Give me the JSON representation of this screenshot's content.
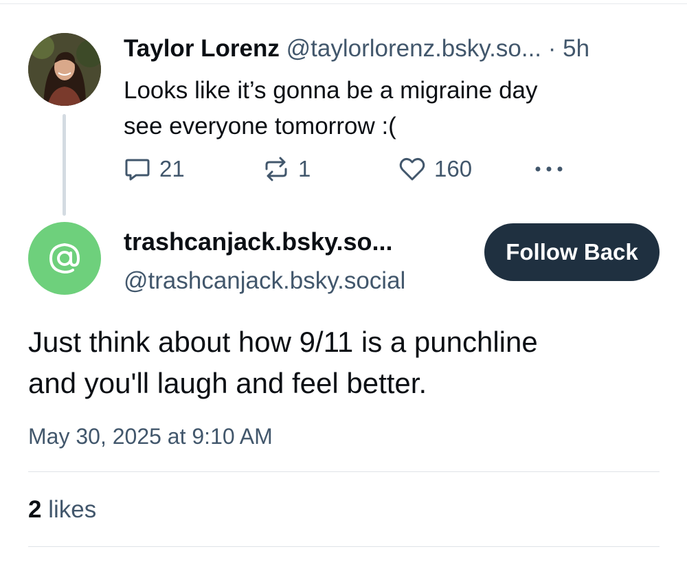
{
  "parent_post": {
    "display_name": "Taylor Lorenz",
    "handle": "@taylorlorenz.bsky.so...",
    "separator": "·",
    "time": "5h",
    "text_lines": [
      "Looks like it’s gonna be a migraine day",
      "see everyone tomorrow :("
    ],
    "reply_count": "21",
    "repost_count": "1",
    "like_count": "160",
    "icons": {
      "reply": "reply-icon",
      "repost": "repost-icon",
      "like": "heart-icon",
      "more": "more-icon"
    }
  },
  "main_post": {
    "display_name": "trashcanjack.bsky.so...",
    "handle": "@trashcanjack.bsky.social",
    "follow_button": "Follow Back",
    "avatar_icon": "at-sign-icon",
    "avatar_color": "#6ed07c",
    "text_lines": [
      "Just think about how 9/11 is a punchline",
      "and you'll laugh and feel better."
    ],
    "timestamp": "May 30, 2025 at 9:10 AM",
    "likes_count": "2",
    "likes_label": "likes"
  },
  "colors": {
    "text": "#0b0f14",
    "muted": "#42576c",
    "button_bg": "#1f3040",
    "thread_line": "#d4dbe2"
  }
}
